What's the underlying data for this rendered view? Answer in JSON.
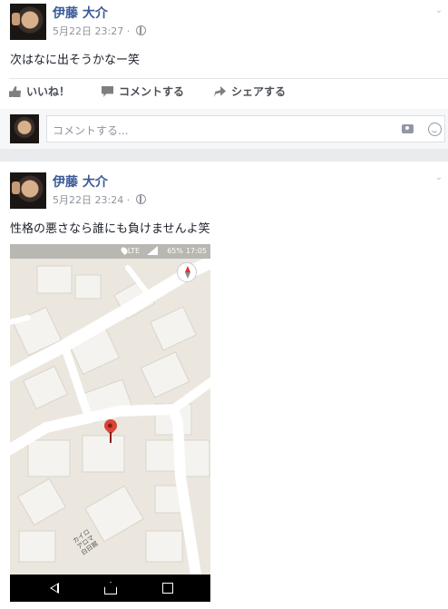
{
  "posts": [
    {
      "author": "伊藤 大介",
      "timestamp": "5月22日 23:27 ·",
      "text": "次はなに出そうかなー笑",
      "actions": {
        "like": "いいね！",
        "comment": "コメントする",
        "share": "シェアする"
      },
      "comment_placeholder": "コメントする..."
    },
    {
      "author": "伊藤 大介",
      "timestamp": "5月22日 23:24 ·",
      "text": "性格の悪さなら誰にも負けませんよ笑",
      "phone_status": {
        "network": "LTE",
        "battery": "65%",
        "time": "17:05"
      },
      "map_label": "カイロ\nアロマ\n白日館"
    }
  ],
  "icons": [
    "globe-icon",
    "like-icon",
    "comment-icon",
    "share-icon",
    "camera-icon",
    "emoji-icon",
    "compass-icon",
    "map-pin-icon",
    "back-icon",
    "home-icon",
    "recent-apps-icon"
  ],
  "colors": {
    "author": "#3b5998",
    "meta": "#90949c",
    "pin": "#db4437"
  }
}
